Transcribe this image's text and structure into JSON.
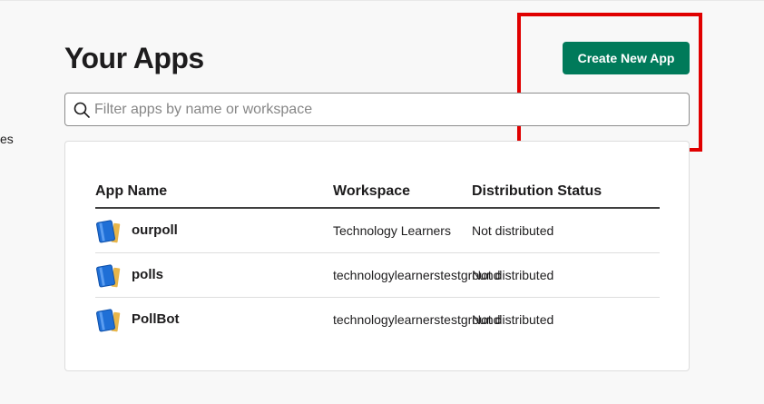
{
  "sidebar": {
    "fragment_text": "es"
  },
  "header": {
    "title": "Your Apps",
    "create_button_label": "Create New App"
  },
  "search": {
    "placeholder": "Filter apps by name or workspace",
    "value": ""
  },
  "table": {
    "headers": {
      "app_name": "App Name",
      "workspace": "Workspace",
      "distribution_status": "Distribution Status"
    },
    "rows": [
      {
        "name": "ourpoll",
        "workspace": "Technology Learners",
        "status": "Not distributed",
        "icon": "app-book-icon"
      },
      {
        "name": "polls",
        "workspace": "technologylearnerstestground",
        "status": "Not distributed",
        "icon": "app-book-icon"
      },
      {
        "name": "PollBot",
        "workspace": "technologylearnerstestground",
        "status": "Not distributed",
        "icon": "app-book-icon"
      }
    ]
  },
  "colors": {
    "primary_button": "#007a5a",
    "highlight": "#e00000",
    "text": "#1d1c1d"
  }
}
